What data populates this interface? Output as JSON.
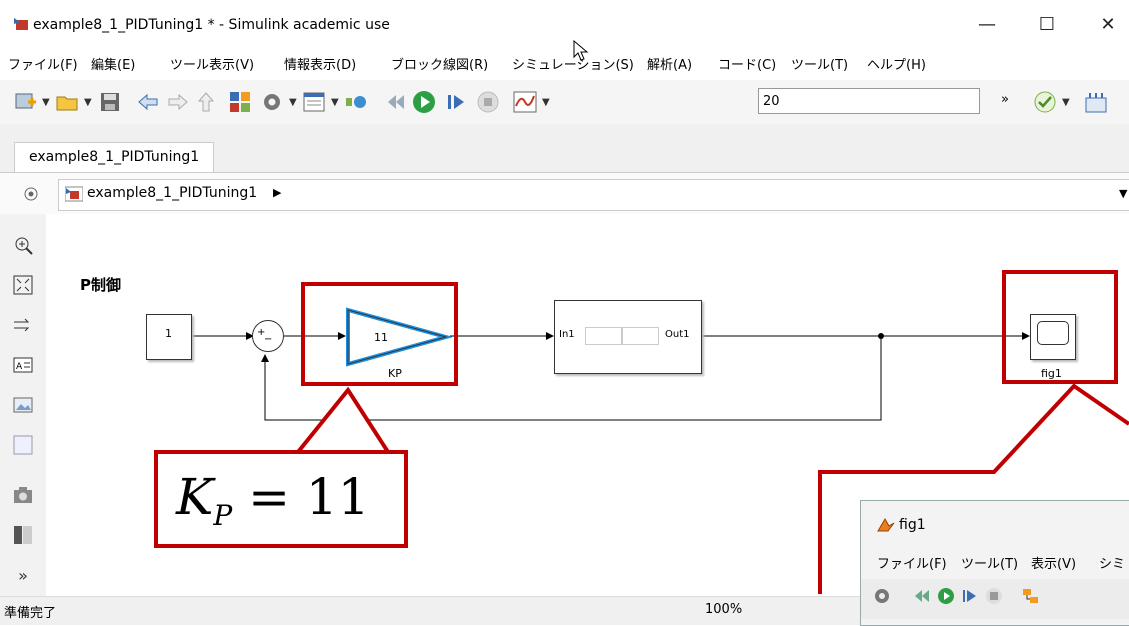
{
  "window": {
    "title": "example8_1_PIDTuning1 * - Simulink academic use",
    "minimize": "—",
    "maximize": "☐",
    "close": "✕"
  },
  "menubar": {
    "items": [
      "ファイル(F)",
      "編集(E)",
      "ツール表示(V)",
      "情報表示(D)",
      "ブロック線図(R)",
      "シミュレーション(S)",
      "解析(A)",
      "コード(C)",
      "ツール(T)",
      "ヘルプ(H)"
    ]
  },
  "toolbar": {
    "stop_time": "20",
    "overflow": "»"
  },
  "tabs": {
    "model_tab": "example8_1_PIDTuning1"
  },
  "breadcrumb": {
    "model": "example8_1_PIDTuning1",
    "arrow": "▶",
    "menu": "▼"
  },
  "diagram": {
    "label": "P制御",
    "constant_value": "1",
    "sum_plus": "+",
    "sum_minus": "−",
    "gain_value": "11",
    "gain_name": "KP",
    "subsystem_in": "In1",
    "subsystem_out": "Out1",
    "scope_name": "fig1"
  },
  "callout": {
    "formula_main": "K",
    "formula_sub": "P",
    "formula_rest": " = 11"
  },
  "fig_window": {
    "title": "fig1",
    "menus": [
      "ファイル(F)",
      "ツール(T)",
      "表示(V)",
      "シミ"
    ]
  },
  "status": {
    "ready": "準備完了",
    "zoom": "100%"
  },
  "palette": {
    "more": "»"
  },
  "colors": {
    "callout_red": "#c00000",
    "gain_border": "#1e8fe0",
    "toolbar_bg": "#f5f5f5"
  }
}
